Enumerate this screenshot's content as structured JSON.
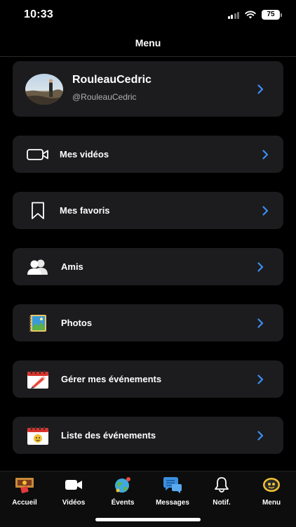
{
  "status": {
    "time": "10:33",
    "battery": "75"
  },
  "header": {
    "title": "Menu"
  },
  "profile": {
    "name": "RouleauCedric",
    "handle": "@RouleauCedric"
  },
  "menu_items": [
    {
      "label": "Mes vidéos",
      "icon": "video-camera-icon"
    },
    {
      "label": "Mes favoris",
      "icon": "bookmark-icon"
    },
    {
      "label": "Amis",
      "icon": "friends-icon"
    },
    {
      "label": "Photos",
      "icon": "photo-album-icon"
    },
    {
      "label": "Gérer mes événements",
      "icon": "calendar-edit-icon"
    },
    {
      "label": "Liste des événements",
      "icon": "calendar-list-icon"
    }
  ],
  "tabs": [
    {
      "label": "Accueil",
      "icon": "ticket-home-icon"
    },
    {
      "label": "Vidéos",
      "icon": "video-camera-icon"
    },
    {
      "label": "Évents",
      "icon": "globe-events-icon"
    },
    {
      "label": "Messages",
      "icon": "chat-bubbles-icon"
    },
    {
      "label": "Notif.",
      "icon": "bell-icon"
    },
    {
      "label": "Menu",
      "icon": "menu-face-icon"
    }
  ],
  "colors": {
    "accent": "#3b8ff3",
    "card": "#1c1c1e",
    "background": "#000000"
  }
}
